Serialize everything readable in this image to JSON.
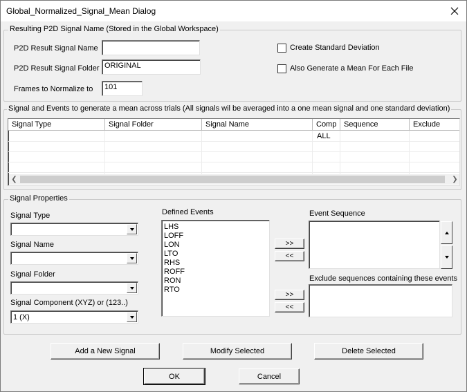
{
  "window": {
    "title": "Global_Normalized_Signal_Mean Dialog"
  },
  "result_group": {
    "legend": "Resulting P2D Signal Name (Stored in the Global Workspace)",
    "signal_name_label": "P2D Result Signal Name",
    "signal_name_value": "",
    "signal_folder_label": "P2D Result Signal Folder",
    "signal_folder_value": "ORIGINAL",
    "frames_label": "Frames to Normalize to",
    "frames_value": "101",
    "create_std_label": "Create Standard Deviation",
    "create_std_checked": false,
    "mean_each_file_label": "Also Generate a Mean For Each File",
    "mean_each_file_checked": false
  },
  "signals_group": {
    "legend": "Signal and Events to generate a mean across trials (All signals wil be averaged into a one mean signal and one standard deviation)",
    "columns": [
      "Signal Type",
      "Signal Folder",
      "Signal Name",
      "Comp",
      "Sequence",
      "Exclude"
    ],
    "rows": [
      [
        "",
        "",
        "",
        "ALL",
        "",
        ""
      ]
    ]
  },
  "props_group": {
    "legend": "Signal Properties",
    "signal_type_label": "Signal Type",
    "signal_type_value": "",
    "signal_name_label": "Signal Name",
    "signal_name_value": "",
    "signal_folder_label": "Signal Folder",
    "signal_folder_value": "",
    "component_label": "Signal Component (XYZ) or (123..)",
    "component_value": "1 (X)",
    "defined_events_label": "Defined Events",
    "defined_events": [
      "LHS",
      "LOFF",
      "LON",
      "LTO",
      "RHS",
      "ROFF",
      "RON",
      "RTO"
    ],
    "event_sequence_label": "Event Sequence",
    "exclude_label": "Exclude sequences containing these events",
    "add_arrow": ">>",
    "remove_arrow": "<<"
  },
  "actions": {
    "add_signal": "Add a New Signal",
    "modify_selected": "Modify Selected",
    "delete_selected": "Delete Selected",
    "ok": "OK",
    "cancel": "Cancel"
  }
}
